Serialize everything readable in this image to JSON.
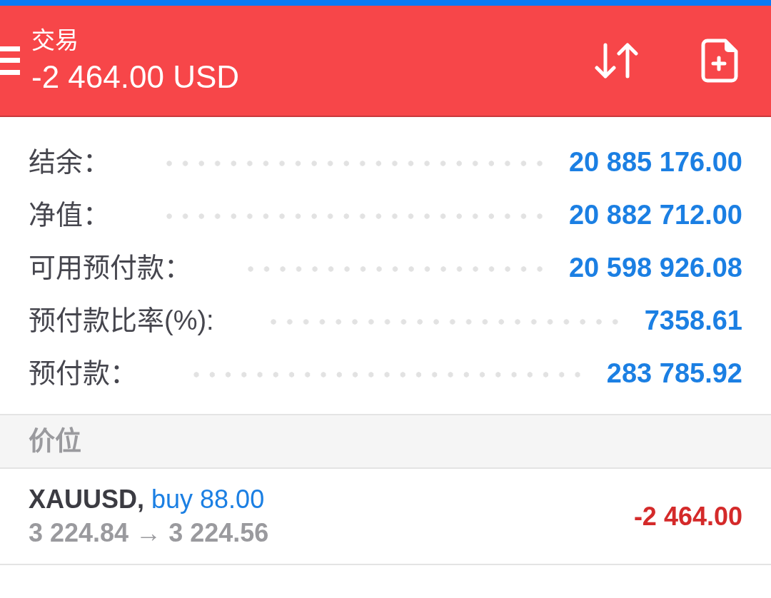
{
  "header": {
    "title": "交易",
    "amount": "-2 464.00 USD"
  },
  "summary": [
    {
      "label": "结余：",
      "value": "20 885 176.00"
    },
    {
      "label": "净值：",
      "value": "20 882 712.00"
    },
    {
      "label": "可用预付款：",
      "value": "20 598 926.08"
    },
    {
      "label": "预付款比率(%):",
      "value": "7358.61"
    },
    {
      "label": "预付款：",
      "value": "283 785.92"
    }
  ],
  "section": {
    "title": "价位"
  },
  "positions": [
    {
      "symbol": "XAUUSD,",
      "order": "buy 88.00",
      "prices": "3 224.84 → 3 224.56",
      "profit": "-2 464.00"
    }
  ]
}
